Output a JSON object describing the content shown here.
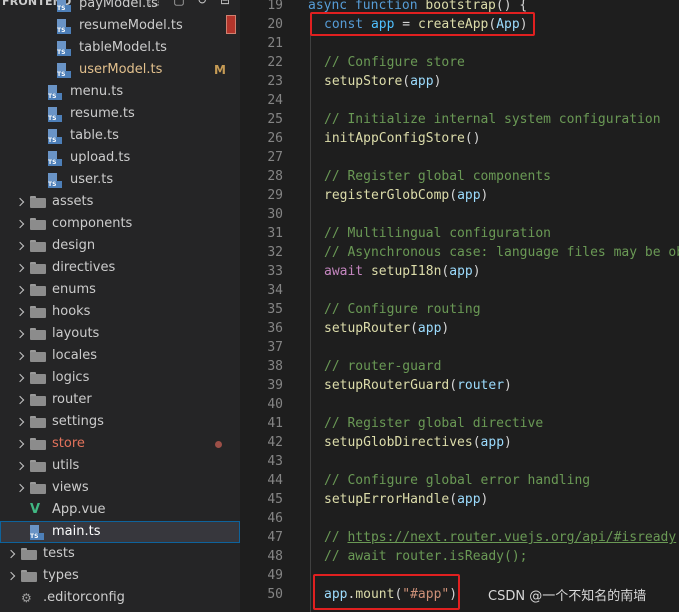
{
  "explorer": {
    "section_title": "FRONTEND",
    "items": [
      {
        "label": "payModel.ts",
        "type": "ts",
        "indent": 4,
        "color": "#cccccc"
      },
      {
        "label": "resumeModel.ts",
        "type": "ts",
        "indent": 4,
        "color": "#cccccc"
      },
      {
        "label": "tableModel.ts",
        "type": "ts",
        "indent": 4,
        "color": "#cccccc"
      },
      {
        "label": "userModel.ts",
        "type": "ts",
        "indent": 4,
        "color": "#e2c08d",
        "badge": "M"
      },
      {
        "label": "menu.ts",
        "type": "ts",
        "indent": 3,
        "color": "#cccccc"
      },
      {
        "label": "resume.ts",
        "type": "ts",
        "indent": 3,
        "color": "#cccccc"
      },
      {
        "label": "table.ts",
        "type": "ts",
        "indent": 3,
        "color": "#cccccc"
      },
      {
        "label": "upload.ts",
        "type": "ts",
        "indent": 3,
        "color": "#cccccc"
      },
      {
        "label": "user.ts",
        "type": "ts",
        "indent": 3,
        "color": "#cccccc"
      },
      {
        "label": "assets",
        "type": "folder",
        "indent": 1,
        "color": "#cccccc"
      },
      {
        "label": "components",
        "type": "folder",
        "indent": 1,
        "color": "#cccccc"
      },
      {
        "label": "design",
        "type": "folder",
        "indent": 1,
        "color": "#cccccc"
      },
      {
        "label": "directives",
        "type": "folder",
        "indent": 1,
        "color": "#cccccc"
      },
      {
        "label": "enums",
        "type": "folder",
        "indent": 1,
        "color": "#cccccc"
      },
      {
        "label": "hooks",
        "type": "folder",
        "indent": 1,
        "color": "#cccccc"
      },
      {
        "label": "layouts",
        "type": "folder",
        "indent": 1,
        "color": "#cccccc"
      },
      {
        "label": "locales",
        "type": "folder",
        "indent": 1,
        "color": "#cccccc"
      },
      {
        "label": "logics",
        "type": "folder",
        "indent": 1,
        "color": "#cccccc"
      },
      {
        "label": "router",
        "type": "folder",
        "indent": 1,
        "color": "#cccccc"
      },
      {
        "label": "settings",
        "type": "folder",
        "indent": 1,
        "color": "#cccccc"
      },
      {
        "label": "store",
        "type": "folder",
        "indent": 1,
        "color": "#e2725b",
        "dot": true
      },
      {
        "label": "utils",
        "type": "folder",
        "indent": 1,
        "color": "#cccccc"
      },
      {
        "label": "views",
        "type": "folder",
        "indent": 1,
        "color": "#cccccc"
      },
      {
        "label": "App.vue",
        "type": "vue",
        "indent": 1,
        "color": "#cccccc"
      },
      {
        "label": "main.ts",
        "type": "ts",
        "indent": 1,
        "color": "#ffffff",
        "selected": true
      },
      {
        "label": "tests",
        "type": "folder",
        "indent": 0,
        "color": "#cccccc"
      },
      {
        "label": "types",
        "type": "folder",
        "indent": 0,
        "color": "#cccccc"
      },
      {
        "label": ".editorconfig",
        "type": "config",
        "indent": 0,
        "color": "#cccccc"
      }
    ]
  },
  "editor": {
    "lines": [
      {
        "n": "19",
        "tokens": [
          [
            "kw",
            "async "
          ],
          [
            "kw",
            "function "
          ],
          [
            "fn",
            "bootstrap"
          ],
          [
            "op",
            "() {"
          ]
        ],
        "indent": 0
      },
      {
        "n": "20",
        "tokens": [
          [
            "kw",
            "const "
          ],
          [
            "var",
            "app"
          ],
          [
            "op",
            " = "
          ],
          [
            "fn",
            "createApp"
          ],
          [
            "op",
            "("
          ],
          [
            "param",
            "App"
          ],
          [
            "op",
            ")"
          ]
        ],
        "indent": 1
      },
      {
        "n": "21",
        "tokens": [],
        "indent": 1
      },
      {
        "n": "22",
        "tokens": [
          [
            "com",
            "// Configure store"
          ]
        ],
        "indent": 1
      },
      {
        "n": "23",
        "tokens": [
          [
            "fn",
            "setupStore"
          ],
          [
            "op",
            "("
          ],
          [
            "param",
            "app"
          ],
          [
            "op",
            ")"
          ]
        ],
        "indent": 1
      },
      {
        "n": "24",
        "tokens": [],
        "indent": 1
      },
      {
        "n": "25",
        "tokens": [
          [
            "com",
            "// Initialize internal system configuration"
          ]
        ],
        "indent": 1
      },
      {
        "n": "26",
        "tokens": [
          [
            "fn",
            "initAppConfigStore"
          ],
          [
            "op",
            "()"
          ]
        ],
        "indent": 1
      },
      {
        "n": "27",
        "tokens": [],
        "indent": 1
      },
      {
        "n": "28",
        "tokens": [
          [
            "com",
            "// Register global components"
          ]
        ],
        "indent": 1
      },
      {
        "n": "29",
        "tokens": [
          [
            "fn",
            "registerGlobComp"
          ],
          [
            "op",
            "("
          ],
          [
            "param",
            "app"
          ],
          [
            "op",
            ")"
          ]
        ],
        "indent": 1
      },
      {
        "n": "30",
        "tokens": [],
        "indent": 1
      },
      {
        "n": "31",
        "tokens": [
          [
            "com",
            "// Multilingual configuration"
          ]
        ],
        "indent": 1
      },
      {
        "n": "32",
        "tokens": [
          [
            "com",
            "// Asynchronous case: language files may be obt"
          ]
        ],
        "indent": 1
      },
      {
        "n": "33",
        "tokens": [
          [
            "ctl",
            "await "
          ],
          [
            "fn",
            "setupI18n"
          ],
          [
            "op",
            "("
          ],
          [
            "param",
            "app"
          ],
          [
            "op",
            ")"
          ]
        ],
        "indent": 1
      },
      {
        "n": "34",
        "tokens": [],
        "indent": 1
      },
      {
        "n": "35",
        "tokens": [
          [
            "com",
            "// Configure routing"
          ]
        ],
        "indent": 1
      },
      {
        "n": "36",
        "tokens": [
          [
            "fn",
            "setupRouter"
          ],
          [
            "op",
            "("
          ],
          [
            "param",
            "app"
          ],
          [
            "op",
            ")"
          ]
        ],
        "indent": 1
      },
      {
        "n": "37",
        "tokens": [],
        "indent": 1
      },
      {
        "n": "38",
        "tokens": [
          [
            "com",
            "// router-guard"
          ]
        ],
        "indent": 1
      },
      {
        "n": "39",
        "tokens": [
          [
            "fn",
            "setupRouterGuard"
          ],
          [
            "op",
            "("
          ],
          [
            "param",
            "router"
          ],
          [
            "op",
            ")"
          ]
        ],
        "indent": 1
      },
      {
        "n": "40",
        "tokens": [],
        "indent": 1
      },
      {
        "n": "41",
        "tokens": [
          [
            "com",
            "// Register global directive"
          ]
        ],
        "indent": 1
      },
      {
        "n": "42",
        "tokens": [
          [
            "fn",
            "setupGlobDirectives"
          ],
          [
            "op",
            "("
          ],
          [
            "param",
            "app"
          ],
          [
            "op",
            ")"
          ]
        ],
        "indent": 1
      },
      {
        "n": "43",
        "tokens": [],
        "indent": 1
      },
      {
        "n": "44",
        "tokens": [
          [
            "com",
            "// Configure global error handling"
          ]
        ],
        "indent": 1
      },
      {
        "n": "45",
        "tokens": [
          [
            "fn",
            "setupErrorHandle"
          ],
          [
            "op",
            "("
          ],
          [
            "param",
            "app"
          ],
          [
            "op",
            ")"
          ]
        ],
        "indent": 1
      },
      {
        "n": "46",
        "tokens": [],
        "indent": 1
      },
      {
        "n": "47",
        "tokens": [
          [
            "com",
            "// "
          ],
          [
            "link",
            "https://next.router.vuejs.org/api/#isready"
          ]
        ],
        "indent": 1
      },
      {
        "n": "48",
        "tokens": [
          [
            "com",
            "// await router.isReady();"
          ]
        ],
        "indent": 1
      },
      {
        "n": "49",
        "tokens": [],
        "indent": 1
      },
      {
        "n": "50",
        "tokens": [
          [
            "param",
            "app"
          ],
          [
            "op",
            "."
          ],
          [
            "fn",
            "mount"
          ],
          [
            "op",
            "("
          ],
          [
            "str",
            "\"#app\""
          ],
          [
            "op",
            ")"
          ]
        ],
        "indent": 1
      }
    ]
  },
  "watermark": "CSDN @一个不知名的南墙",
  "colors": {
    "highlight_box": "#e02020",
    "selection_outline": "#0e639c",
    "modified_badge": "#c69b55"
  }
}
